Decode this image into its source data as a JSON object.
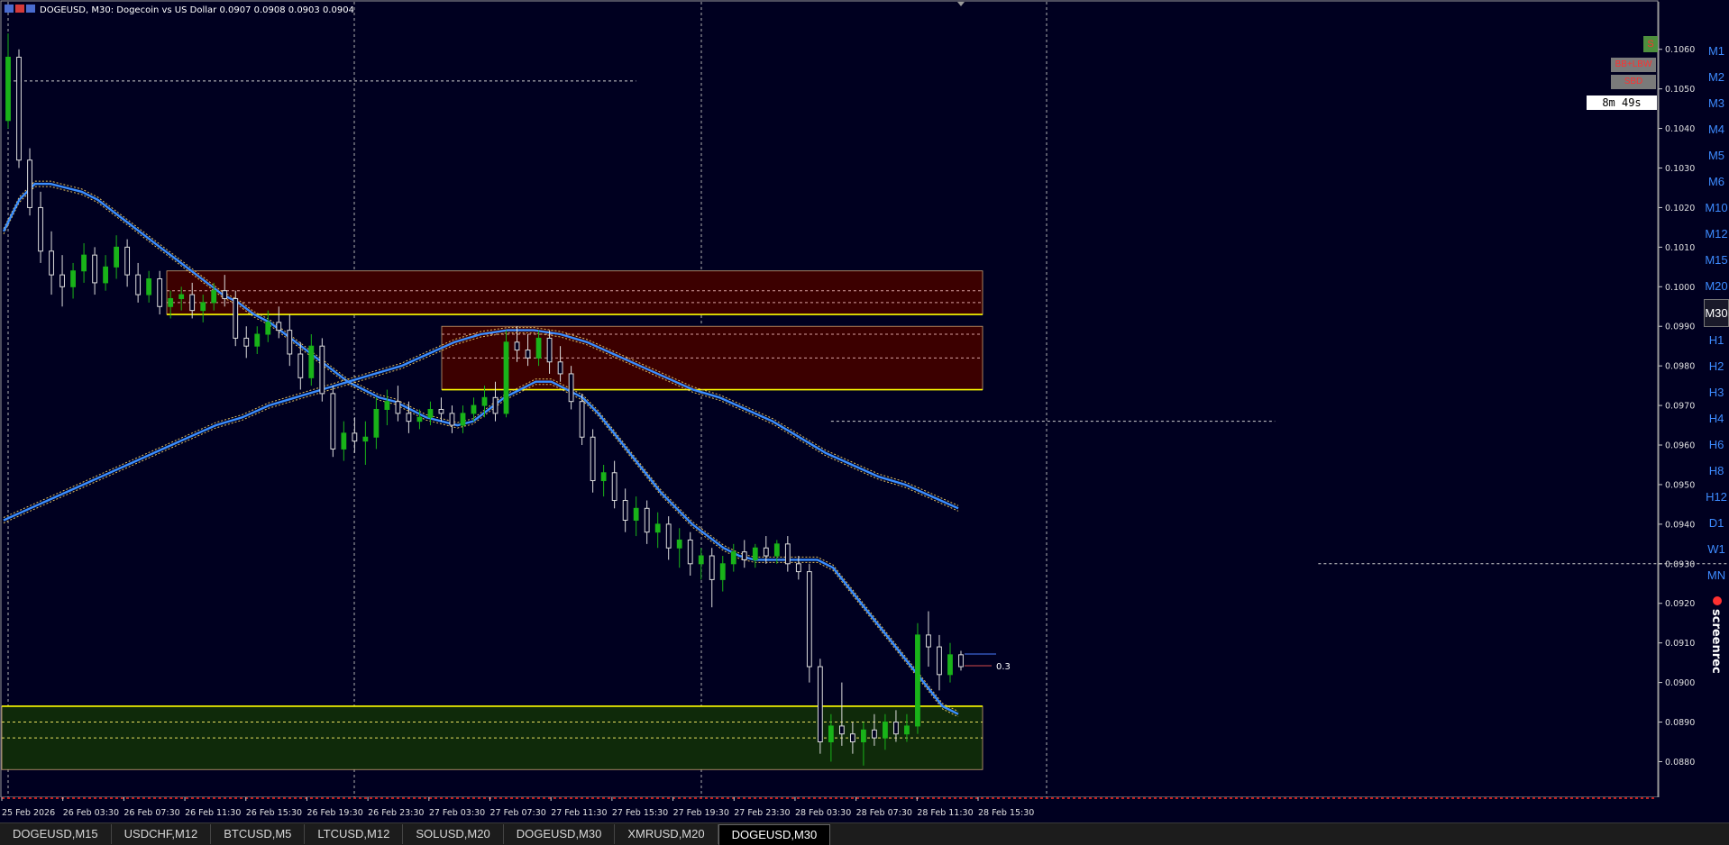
{
  "header": {
    "title": "DOGEUSD, M30:  Dogecoin vs US Dollar  0.0907 0.0908 0.0903 0.0904"
  },
  "colors": {
    "background": "#000020",
    "bull": "#19b319",
    "bear": "#dcdcdc",
    "zone_resistance": "#3c0000",
    "zone_support": "#0f2a0a",
    "zone_line": "#ffff00",
    "ma_line": "#3a8dff",
    "ma_border": "#e0c060",
    "grid": "#b0b0b0"
  },
  "timer_text": "8m 49s",
  "buttons": {
    "corner_label": "S",
    "btn_a": "BB+LBW",
    "btn_b": "SBD"
  },
  "price_label_value": "0.3",
  "timeframes": [
    "M1",
    "M2",
    "M3",
    "M4",
    "M5",
    "M6",
    "M10",
    "M12",
    "M15",
    "M20",
    "M30",
    "H1",
    "H2",
    "H3",
    "H4",
    "H6",
    "H8",
    "H12",
    "D1",
    "W1",
    "MN"
  ],
  "active_timeframe": "M30",
  "watermark": "screenrec",
  "tabs": [
    "DOGEUSD,M15",
    "USDCHF,M12",
    "BTCUSD,M5",
    "LTCUSD,M12",
    "SOLUSD,M20",
    "DOGEUSD,M30",
    "XMRUSD,M20",
    "DOGEUSD,M30"
  ],
  "active_tab_index": 7,
  "chart_data": {
    "type": "line",
    "title": "DOGEUSD, M30:  Dogecoin vs US Dollar  0.0907 0.0908 0.0903 0.0904",
    "xlabel": "",
    "ylabel": "",
    "ylim": [
      0.0871,
      0.1072
    ],
    "y_ticks": [
      "0.1060",
      "0.1050",
      "0.1040",
      "0.1030",
      "0.1020",
      "0.1010",
      "0.1000",
      "0.0990",
      "0.0980",
      "0.0970",
      "0.0960",
      "0.0950",
      "0.0940",
      "0.0930",
      "0.0920",
      "0.0910",
      "0.0900",
      "0.0890",
      "0.0880"
    ],
    "x_ticks": [
      "25 Feb 2026",
      "26 Feb 03:30",
      "26 Feb 07:30",
      "26 Feb 11:30",
      "26 Feb 15:30",
      "26 Feb 19:30",
      "26 Feb 23:30",
      "27 Feb 03:30",
      "27 Feb 07:30",
      "27 Feb 11:30",
      "27 Feb 15:30",
      "27 Feb 19:30",
      "27 Feb 23:30",
      "28 Feb 03:30",
      "28 Feb 07:30",
      "28 Feb 11:30",
      "28 Feb 15:30"
    ],
    "grid": false,
    "zones": [
      {
        "type": "resistance",
        "top": 0.1004,
        "bottom": 0.0993,
        "mid_lines": [
          0.0999,
          0.0996
        ]
      },
      {
        "type": "resistance",
        "top": 0.099,
        "bottom": 0.0974,
        "mid_lines": [
          0.0988,
          0.0982
        ]
      },
      {
        "type": "support",
        "top": 0.0894,
        "bottom": 0.0878,
        "mid_lines": [
          0.089,
          0.0886
        ]
      }
    ],
    "levels": [
      {
        "value": 0.1052,
        "from_bar": 0,
        "to_bar": 58
      },
      {
        "value": 0.0966,
        "from_bar": 76,
        "to_bar": 117
      },
      {
        "value": 0.093,
        "from_bar": 121,
        "to_bar": 164
      }
    ],
    "series": [
      {
        "key": "fast_ma",
        "values": [
          0.1014,
          0.1022,
          0.1026,
          0.1026,
          0.1025,
          0.1024,
          0.1022,
          0.1019,
          0.1016,
          0.1013,
          0.101,
          0.1007,
          0.1004,
          0.1001,
          0.0998,
          0.0996,
          0.0993,
          0.0991,
          0.0988,
          0.0985,
          0.0982,
          0.0979,
          0.0976,
          0.0974,
          0.0972,
          0.0971,
          0.0969,
          0.0967,
          0.0966,
          0.0965,
          0.0966,
          0.0969,
          0.0972,
          0.0974,
          0.0976,
          0.0976,
          0.0974,
          0.0972,
          0.0968,
          0.0963,
          0.0958,
          0.0953,
          0.0948,
          0.0944,
          0.094,
          0.0937,
          0.0934,
          0.0932,
          0.0931,
          0.0931,
          0.0931,
          0.0931,
          0.0931,
          0.0929,
          0.0924,
          0.0919,
          0.0914,
          0.0909,
          0.0904,
          0.0899,
          0.0894,
          0.0892
        ]
      },
      {
        "key": "slow_ma",
        "values": [
          0.0941,
          0.0944,
          0.0947,
          0.095,
          0.0953,
          0.0956,
          0.0959,
          0.0962,
          0.0965,
          0.0967,
          0.097,
          0.0972,
          0.0974,
          0.0976,
          0.0978,
          0.098,
          0.0983,
          0.0986,
          0.0988,
          0.0989,
          0.0989,
          0.0988,
          0.0986,
          0.0983,
          0.098,
          0.0977,
          0.0974,
          0.0972,
          0.0969,
          0.0966,
          0.0962,
          0.0958,
          0.0955,
          0.0952,
          0.095,
          0.0947,
          0.0944
        ]
      },
      {
        "key": "candles",
        "ohlc": [
          [
            0.1042,
            0.1064,
            0.104,
            0.1058
          ],
          [
            0.1058,
            0.106,
            0.103,
            0.1032
          ],
          [
            0.1032,
            0.1035,
            0.1018,
            0.102
          ],
          [
            0.102,
            0.1024,
            0.1006,
            0.1009
          ],
          [
            0.1009,
            0.1014,
            0.0998,
            0.1003
          ],
          [
            0.1003,
            0.1008,
            0.0995,
            0.1
          ],
          [
            0.1,
            0.1006,
            0.0997,
            0.1004
          ],
          [
            0.1004,
            0.1011,
            0.1001,
            0.1008
          ],
          [
            0.1008,
            0.101,
            0.0998,
            0.1001
          ],
          [
            0.1001,
            0.1008,
            0.0999,
            0.1005
          ],
          [
            0.1005,
            0.1013,
            0.1002,
            0.101
          ],
          [
            0.101,
            0.1012,
            0.1,
            0.1003
          ],
          [
            0.1003,
            0.1006,
            0.0996,
            0.0998
          ],
          [
            0.0998,
            0.1004,
            0.0996,
            0.1002
          ],
          [
            0.1002,
            0.1004,
            0.0993,
            0.0995
          ],
          [
            0.0995,
            0.0999,
            0.0992,
            0.0997
          ],
          [
            0.0997,
            0.1,
            0.0994,
            0.0998
          ],
          [
            0.0998,
            0.1001,
            0.0992,
            0.0994
          ],
          [
            0.0994,
            0.0998,
            0.0991,
            0.0996
          ],
          [
            0.0996,
            0.1001,
            0.0994,
            0.0999
          ],
          [
            0.0999,
            0.1003,
            0.0995,
            0.0997
          ],
          [
            0.0997,
            0.0999,
            0.0985,
            0.0987
          ],
          [
            0.0987,
            0.099,
            0.0982,
            0.0985
          ],
          [
            0.0985,
            0.099,
            0.0983,
            0.0988
          ],
          [
            0.0988,
            0.0994,
            0.0986,
            0.0991
          ],
          [
            0.0991,
            0.0995,
            0.0987,
            0.0989
          ],
          [
            0.0989,
            0.0993,
            0.098,
            0.0983
          ],
          [
            0.0983,
            0.0986,
            0.0974,
            0.0977
          ],
          [
            0.0977,
            0.0988,
            0.0975,
            0.0985
          ],
          [
            0.0985,
            0.0987,
            0.0971,
            0.0973
          ],
          [
            0.0973,
            0.0975,
            0.0957,
            0.0959
          ],
          [
            0.0959,
            0.0966,
            0.0956,
            0.0963
          ],
          [
            0.0963,
            0.0967,
            0.0958,
            0.0961
          ],
          [
            0.0961,
            0.0966,
            0.0955,
            0.0962
          ],
          [
            0.0962,
            0.0972,
            0.0959,
            0.0969
          ],
          [
            0.0969,
            0.0974,
            0.0965,
            0.0971
          ],
          [
            0.0971,
            0.0975,
            0.0966,
            0.0968
          ],
          [
            0.0968,
            0.0971,
            0.0963,
            0.0966
          ],
          [
            0.0966,
            0.0969,
            0.0964,
            0.0967
          ],
          [
            0.0967,
            0.0971,
            0.0965,
            0.0969
          ],
          [
            0.0969,
            0.0972,
            0.0966,
            0.0968
          ],
          [
            0.0968,
            0.097,
            0.0963,
            0.0965
          ],
          [
            0.0965,
            0.097,
            0.0963,
            0.0968
          ],
          [
            0.0968,
            0.0972,
            0.0966,
            0.097
          ],
          [
            0.097,
            0.0975,
            0.0967,
            0.0972
          ],
          [
            0.0972,
            0.0976,
            0.0966,
            0.0968
          ],
          [
            0.0968,
            0.0989,
            0.0967,
            0.0986
          ],
          [
            0.0986,
            0.099,
            0.0981,
            0.0984
          ],
          [
            0.0984,
            0.0988,
            0.098,
            0.0982
          ],
          [
            0.0982,
            0.0989,
            0.098,
            0.0987
          ],
          [
            0.0987,
            0.0989,
            0.0978,
            0.0981
          ],
          [
            0.0981,
            0.0985,
            0.0976,
            0.0978
          ],
          [
            0.0978,
            0.098,
            0.0969,
            0.0971
          ],
          [
            0.0971,
            0.0973,
            0.096,
            0.0962
          ],
          [
            0.0962,
            0.0964,
            0.0948,
            0.0951
          ],
          [
            0.0951,
            0.0955,
            0.0947,
            0.0953
          ],
          [
            0.0953,
            0.0956,
            0.0944,
            0.0946
          ],
          [
            0.0946,
            0.0949,
            0.0938,
            0.0941
          ],
          [
            0.0941,
            0.0947,
            0.0937,
            0.0944
          ],
          [
            0.0944,
            0.0946,
            0.0935,
            0.0938
          ],
          [
            0.0938,
            0.0943,
            0.0934,
            0.094
          ],
          [
            0.094,
            0.0942,
            0.0931,
            0.0934
          ],
          [
            0.0934,
            0.0939,
            0.0929,
            0.0936
          ],
          [
            0.0936,
            0.0938,
            0.0927,
            0.093
          ],
          [
            0.093,
            0.0934,
            0.0926,
            0.0932
          ],
          [
            0.0932,
            0.0934,
            0.0919,
            0.0926
          ],
          [
            0.0926,
            0.0932,
            0.0923,
            0.093
          ],
          [
            0.093,
            0.0935,
            0.0928,
            0.0933
          ],
          [
            0.0933,
            0.0936,
            0.0929,
            0.0931
          ],
          [
            0.0931,
            0.0935,
            0.0929,
            0.0934
          ],
          [
            0.0934,
            0.0937,
            0.093,
            0.0932
          ],
          [
            0.0932,
            0.0936,
            0.093,
            0.0935
          ],
          [
            0.0935,
            0.0937,
            0.0928,
            0.093
          ],
          [
            0.093,
            0.0932,
            0.0926,
            0.0928
          ],
          [
            0.0928,
            0.093,
            0.09,
            0.0904
          ],
          [
            0.0904,
            0.0906,
            0.0882,
            0.0885
          ],
          [
            0.0885,
            0.0892,
            0.088,
            0.0889
          ],
          [
            0.0889,
            0.09,
            0.0884,
            0.0887
          ],
          [
            0.0887,
            0.089,
            0.0882,
            0.0885
          ],
          [
            0.0885,
            0.089,
            0.0879,
            0.0888
          ],
          [
            0.0888,
            0.0892,
            0.0884,
            0.0886
          ],
          [
            0.0886,
            0.0892,
            0.0883,
            0.089
          ],
          [
            0.089,
            0.0893,
            0.0885,
            0.0887
          ],
          [
            0.0887,
            0.0892,
            0.0885,
            0.0889
          ],
          [
            0.0889,
            0.0915,
            0.0887,
            0.0912
          ],
          [
            0.0912,
            0.0918,
            0.0904,
            0.0909
          ],
          [
            0.0909,
            0.0912,
            0.0898,
            0.0902
          ],
          [
            0.0902,
            0.091,
            0.09,
            0.0907
          ],
          [
            0.0907,
            0.0908,
            0.0903,
            0.0904
          ]
        ]
      }
    ]
  }
}
